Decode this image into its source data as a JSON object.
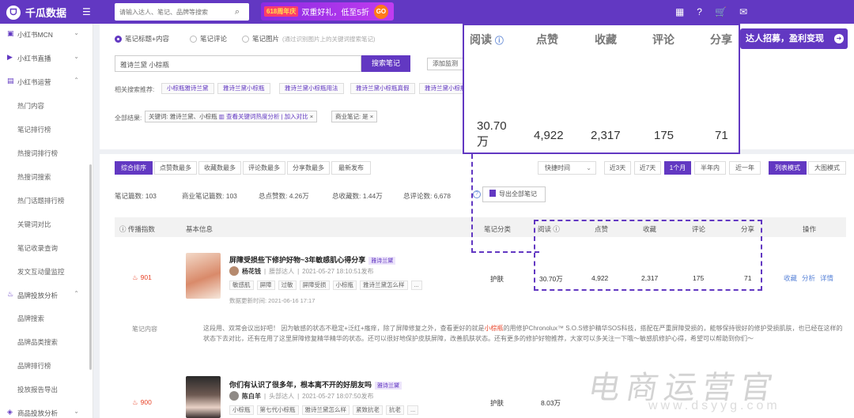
{
  "brand": {
    "name": "千瓜数据",
    "logo_glyph": "ᗜ",
    "accent": "#6238c2"
  },
  "search": {
    "placeholder": "请输入达人、笔记、品牌等搜索"
  },
  "promo": {
    "tag": "618周年庆",
    "text": "双重好礼，低至5折",
    "go": "GO"
  },
  "recruit": {
    "label": "达人招募，盈利变现"
  },
  "sidebar": {
    "sections": [
      {
        "label": "小红书MCN",
        "icon": "id-card-icon"
      },
      {
        "label": "小红书直播",
        "icon": "video-icon"
      },
      {
        "label": "小红书运营",
        "icon": "chart-icon"
      },
      {
        "label": "品牌投放分析",
        "icon": "flame-icon"
      },
      {
        "label": "商品投放分析",
        "icon": "bag-icon"
      }
    ],
    "ops_items": [
      "热门内容",
      "笔记排行榜",
      "热搜词排行榜",
      "热搜词搜索",
      "热门话题排行榜",
      "关键词对比",
      "笔记收录查询",
      "发文互动量监控"
    ],
    "brand_items": [
      "品牌搜索",
      "品牌品类搜索",
      "品牌排行榜",
      "投放报告导出"
    ]
  },
  "search_panel": {
    "radios": [
      "笔记标题+内容",
      "笔记评论",
      "笔记图片"
    ],
    "radio_hint": "(通过识别图片上的关键词搜索笔记)",
    "keyword": "雅诗兰黛 小棕瓶",
    "search_button": "搜索笔记",
    "add_button": "添加监测",
    "related_label": "相关搜索推荐:",
    "related": [
      "小棕瓶雅诗兰黛",
      "雅诗兰黛小棕瓶",
      "雅诗兰黛小棕瓶用法",
      "雅诗兰黛小棕瓶真假",
      "雅诗兰黛小棕瓶"
    ],
    "all_label": "全部结果:",
    "filter_kw_prefix": "关键词:",
    "filter_kw": "雅诗兰黛、小棕瓶",
    "filter_view": "查看关键词热度分析",
    "filter_compare": "加入对比",
    "filter_commercial": "商业笔记: 是"
  },
  "toolbar": {
    "sort_tabs": [
      "综合排序",
      "点赞数最多",
      "收藏数最多",
      "评论数最多",
      "分享数最多",
      "最新发布"
    ],
    "time_select": "快捷时间",
    "range_tabs": [
      "近3天",
      "近7天",
      "1个月",
      "半年内",
      "近一年"
    ],
    "view_tabs": [
      "列表模式",
      "大图模式"
    ]
  },
  "summary": {
    "notes": "笔记篇数: 103",
    "commercial": "商业笔记篇数: 103",
    "likes": "总点赞数: 4.26万",
    "collects": "总收藏数: 1.44万",
    "comments": "总评论数: 6,678",
    "export": "导出全部笔记"
  },
  "table": {
    "headers": [
      "传播指数",
      "基本信息",
      "笔记分类",
      "阅读",
      "点赞",
      "收藏",
      "评论",
      "分享",
      "操作"
    ],
    "rows": [
      {
        "index": "901",
        "title": "屏障受损些下修护好物~3年敏感肌心得分享",
        "badge": "雅诗兰黛",
        "author": "杨花钱",
        "author_level": "腰部达人",
        "published": "2021-05-27 18:10:51发布",
        "tags": [
          "敏感肌",
          "屏障",
          "过敏",
          "屏障受损",
          "小棕瓶",
          "雅诗兰黛怎么样",
          "..."
        ],
        "updated": "数据更新时间: 2021-06-16 17:17",
        "category": "护肤",
        "reads": "30.70万",
        "likes": "4,922",
        "collects": "2,317",
        "comments": "175",
        "shares": "71",
        "ops": [
          "收藏",
          "分析",
          "详情"
        ]
      },
      {
        "index": "900",
        "title": "你们有认识了很多年，根本离不开的好朋友吗",
        "badge": "雅诗兰黛",
        "author": "陈白羊",
        "author_level": "头部达人",
        "published": "2021-05-27 18:07:50发布",
        "tags": [
          "小棕瓶",
          "第七代小棕瓶",
          "雅诗兰黛怎么样",
          "紧致抗老",
          "抗老",
          "..."
        ],
        "category": "护肤",
        "reads": "8.03万"
      }
    ],
    "content_label": "笔记内容",
    "content_text_pre": "这段用、双常会议出好吧！ 因为敏感的状态不稳定+泛红+瘙痒，除了屏障修复之外，查看更好的就是",
    "content_text_kw": "小棕瓶",
    "content_text_post": "的用修护Chronolux™ S.O.S修护精华SOS科技，搭配在严重屏障受损的，能够保持很好的修护受损肌肤，也已经在这样的状态下去对比，还有在用了这里屏障修复精华精华的状态。还可以很好地保护皮肤屏障，改善肌肤状态。还有更多的修护好物推荐，大家可以多关注一下哦～敏感肌修护心得，希望可以帮助到你们～"
  },
  "zoom": {
    "headers": [
      "阅读",
      "点赞",
      "收藏",
      "评论",
      "分享"
    ],
    "values": [
      "30.70万",
      "4,922",
      "2,317",
      "175",
      "71"
    ]
  },
  "watermark": {
    "text": "电商运营官",
    "sub": "www.dsyyg.com"
  }
}
